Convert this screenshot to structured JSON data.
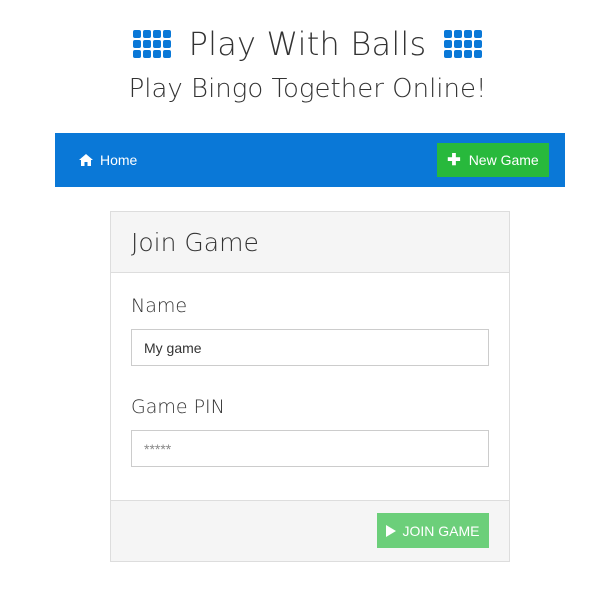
{
  "header": {
    "title": "Play With Balls",
    "subtitle": "Play Bingo Together Online!",
    "icon": "grid-icon",
    "accent_color": "#0a78d7"
  },
  "navbar": {
    "home_label": "Home",
    "home_icon": "home-icon",
    "new_game_label": "New Game",
    "new_game_icon": "plus-icon",
    "background_color": "#0a78d7",
    "new_game_color": "#28b93c"
  },
  "join_panel": {
    "title": "Join Game",
    "name_label": "Name",
    "name_value": "My game",
    "pin_label": "Game PIN",
    "pin_placeholder": "*****",
    "join_label": "JOIN GAME",
    "join_icon": "play-icon",
    "join_color": "#6ccf7a"
  }
}
